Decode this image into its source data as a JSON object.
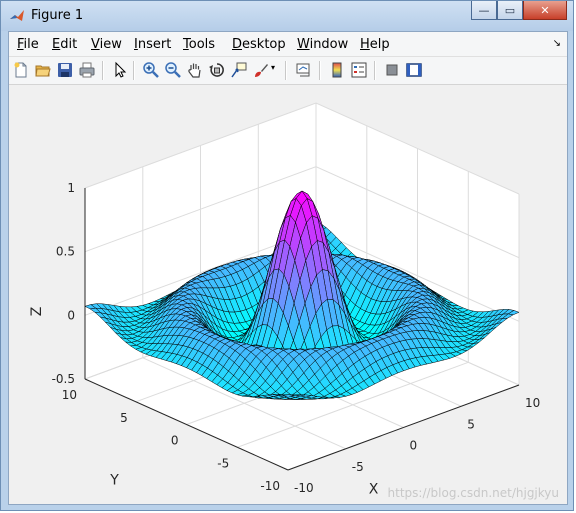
{
  "window": {
    "title": "Figure 1",
    "buttons": {
      "minimize": "—",
      "maximize": "▭",
      "close": "✕"
    }
  },
  "menubar": {
    "items": [
      "File",
      "Edit",
      "View",
      "Insert",
      "Tools",
      "Desktop",
      "Window",
      "Help"
    ],
    "overflow": "↘"
  },
  "toolbar": {
    "buttons": [
      "new-figure-icon",
      "open-file-icon",
      "save-icon",
      "print-icon",
      "edit-plot-icon",
      "zoom-in-icon",
      "zoom-out-icon",
      "pan-icon",
      "rotate-3d-icon",
      "data-cursor-icon",
      "brush-icon",
      "link-plot-icon",
      "colorbar-icon",
      "legend-icon",
      "hide-plot-tools-icon",
      "show-plot-tools-icon"
    ]
  },
  "chart_data": {
    "type": "surface",
    "function": "z = sin(R)/R, R = sqrt(x^2 + y^2)",
    "x": {
      "label": "X",
      "range": [
        -10,
        10
      ],
      "ticks": [
        "-10",
        "-5",
        "0",
        "5",
        "10"
      ]
    },
    "y": {
      "label": "Y",
      "range": [
        -10,
        10
      ],
      "ticks": [
        "-10",
        "-5",
        "0",
        "5",
        "10"
      ]
    },
    "z": {
      "label": "Z",
      "range": [
        -0.5,
        1
      ],
      "ticks": [
        "-0.5",
        "0",
        "0.5",
        "1"
      ]
    },
    "grid": true,
    "colormap": "cool",
    "colors": {
      "low": "#00ffff",
      "high": "#ff00ff",
      "edge": "#000000",
      "axes_bg": "#ffffff",
      "figure_bg": "#f0f0f0"
    }
  },
  "watermark": "https://blog.csdn.net/hjgjkyu"
}
